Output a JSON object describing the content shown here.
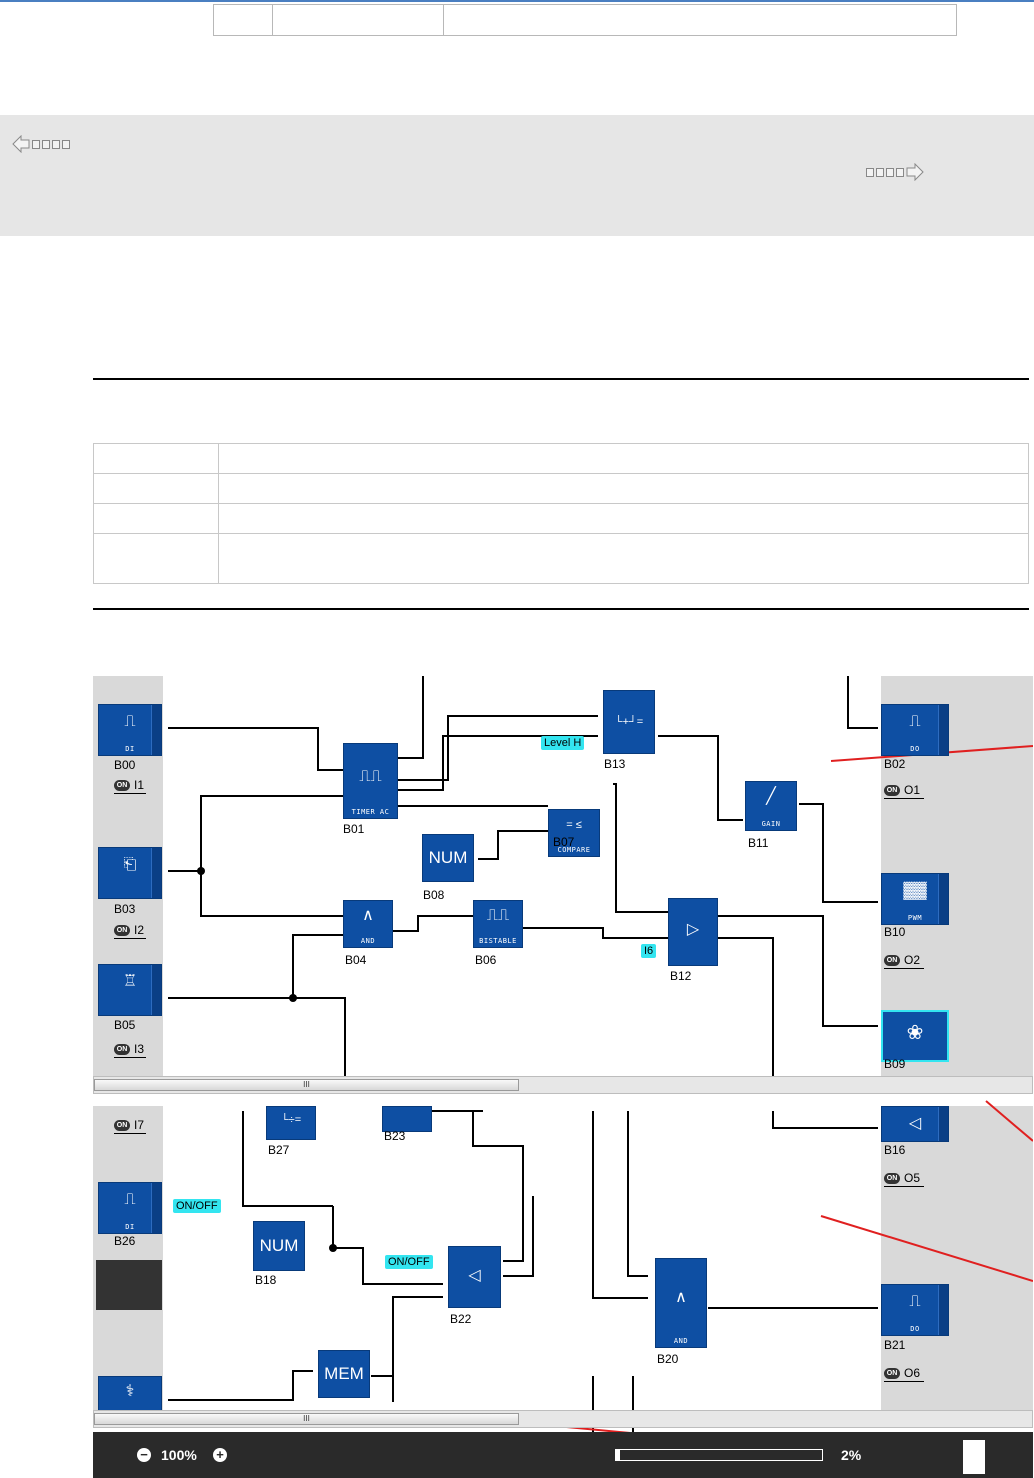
{
  "toolbar": {
    "zoom_label": "100%",
    "progress_label": "2%",
    "progress_value": 0.02
  },
  "scrollbar_grip": "III",
  "blocks": {
    "B00": {
      "name": "B00",
      "label": "DI",
      "io": "I1"
    },
    "B01": {
      "name": "B01",
      "label": "TIMER AC"
    },
    "B02": {
      "name": "B02",
      "label": "DO",
      "io": "O1"
    },
    "B03": {
      "name": "B03",
      "io": "I2"
    },
    "B04": {
      "name": "B04",
      "label": "AND"
    },
    "B05": {
      "name": "B05",
      "io": "I3"
    },
    "B06": {
      "name": "B06",
      "label": "BISTABLE"
    },
    "B07": {
      "name": "B07",
      "label": "COMPARE"
    },
    "B08": {
      "name": "B08",
      "label": "NUM"
    },
    "B09": {
      "name": "B09"
    },
    "B10": {
      "name": "B10",
      "label": "PWM",
      "io": "O2"
    },
    "B11": {
      "name": "B11",
      "label": "GAIN"
    },
    "B12": {
      "name": "B12"
    },
    "B13": {
      "name": "B13"
    },
    "B16": {
      "name": "B16",
      "io": "O5"
    },
    "B18": {
      "name": "B18",
      "label": "NUM"
    },
    "B20": {
      "name": "B20",
      "label": "AND"
    },
    "B21": {
      "name": "B21",
      "label": "DO",
      "io": "O6"
    },
    "B22": {
      "name": "B22"
    },
    "B23": {
      "name": "B23"
    },
    "B26": {
      "name": "B26",
      "label": "DI"
    },
    "B27": {
      "name": "B27"
    },
    "MEM": {
      "label": "MEM"
    }
  },
  "io_top_partial": "I7",
  "tags": {
    "level_h": "Level H",
    "i6": "I6",
    "on_off_1": "ON/OFF",
    "on_off_2": "ON/OFF"
  },
  "colors": {
    "block_blue": "#0e4fa3",
    "tag_cyan": "#33e5f0",
    "panel_gray": "#d9d9d9",
    "annotation_red": "#e02020",
    "nav_bg": "#e6e6e6",
    "footer_bg": "#2a2a2a"
  },
  "icons": {
    "nav_prev": "arrow-left-icon",
    "nav_next": "arrow-right-icon",
    "zoom_out": "minus-circle-icon",
    "zoom_in": "plus-circle-icon"
  }
}
